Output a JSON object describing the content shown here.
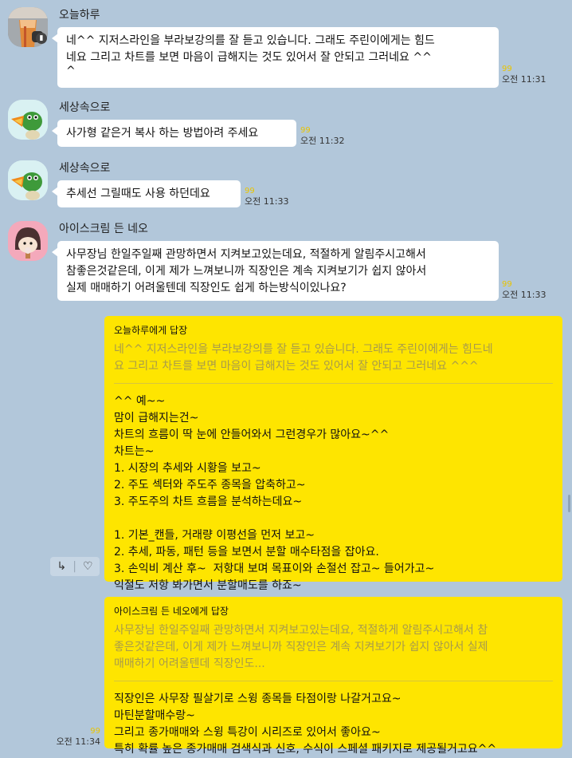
{
  "messages": [
    {
      "sender": "오늘하루",
      "text_lines": [
        "네^^ 지저스라인을 부라보강의를 잘 듣고 있습니다. 그래도 주린이에게는 힘드",
        "네요 그리고 차트를 보면 마음이 급해지는 것도 있어서 잘 안되고 그러네요 ^^",
        "^"
      ],
      "unread": "99",
      "time": "오전 11:31"
    },
    {
      "sender": "세상속으로",
      "text_lines": [
        "사가형 같은거 복사 하는 방법아려 주세요"
      ],
      "unread": "99",
      "time": "오전 11:32"
    },
    {
      "sender": "세상속으로",
      "text_lines": [
        "추세선 그릴때도 사용 하던데요"
      ],
      "unread": "99",
      "time": "오전 11:33"
    },
    {
      "sender": "아이스크림 든 네오",
      "text_lines": [
        "사무장님 한일주일째 관망하면서 지켜보고있는데요, 적절하게 알림주시고해서",
        "참좋은것같은데, 이게 제가 느껴보니까 직장인은 계속 지켜보기가 쉽지 않아서",
        "실제 매매하기 어려울텐데 직장인도 쉽게 하는방식이있나요?"
      ],
      "unread": "99",
      "time": "오전 11:33"
    }
  ],
  "my_replies": [
    {
      "reply_to": "오늘하루에게 답장",
      "quote_lines": [
        "네^^ 지저스라인을 부라보강의를 잘 듣고 있습니다. 그래도 주린이에게는 힘드네",
        "요 그리고 차트를 보면 마음이 급해지는 것도 있어서 잘 안되고 그러네요 ^^^"
      ],
      "body_lines": [
        "^^ 예~~",
        "맘이 급해지는건~",
        "차트의 흐름이 딱 눈에 안들어와서 그런경우가 많아요~^^",
        "차트는~",
        "1. 시장의 추세와 시황을 보고~",
        "2. 주도 섹터와 주도주 종목을 압축하고~",
        "3. 주도주의 차트 흐름을 분석하는데요~",
        "",
        "1. 기본_캔들, 거래량 이평선을 먼저 보고~",
        "2. 추세, 파동, 패턴 등을 보면서 분할 매수타점을 잡아요.",
        "3. 손익비 계산 후~  저항대 보며 목표이와 손절선 잡고~ 들어가고~",
        "익절도 저항 봐가면서 분할매도를 하죠~"
      ]
    },
    {
      "reply_to": "아이스크림 든 네오에게 답장",
      "quote_lines": [
        "사무장님 한일주일째 관망하면서 지켜보고있는데요, 적절하게 알림주시고해서 참",
        "좋은것같은데, 이게 제가 느껴보니까 직장인은 계속 지켜보기가 쉽지 않아서 실제",
        "매매하기 어려울텐데 직장인도..."
      ],
      "body_lines": [
        "직장인은 사무장 필살기로 스윙 종목들 타점이랑 나갈거고요~",
        "마틴분할매수랑~",
        "그리고 종가매매와 스윙 특강이 시리즈로 있어서 좋아요~",
        "특히 확률 높은 종가매매 검색식과 신호, 수식이 스페셜 패키지로 제공될거고요^^"
      ],
      "unread": "99",
      "time": "오전 11:34"
    }
  ],
  "actions": {
    "reply_icon": "reply-arrow-icon",
    "like_icon": "heart-icon",
    "reply_glyph": "↳",
    "like_glyph": "♡"
  }
}
